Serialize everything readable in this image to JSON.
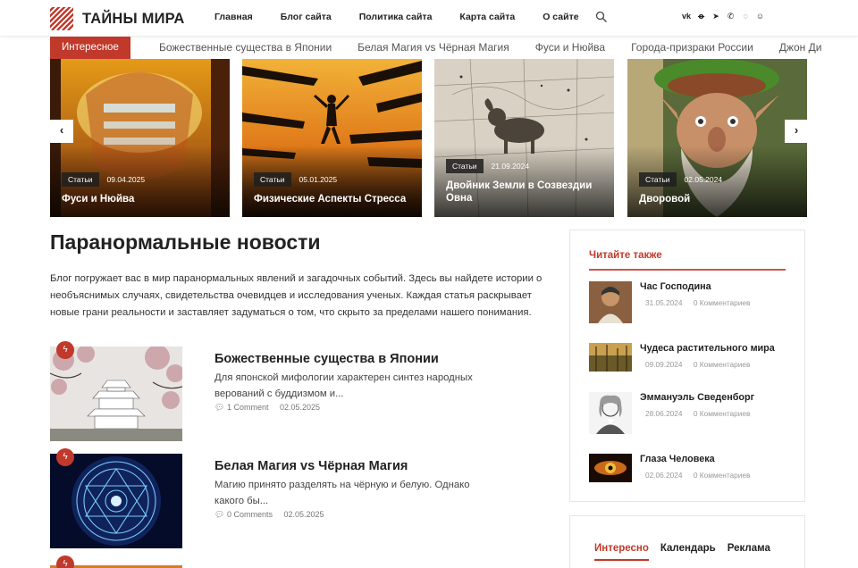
{
  "site": {
    "name": "ТАЙНЫ МИРА"
  },
  "nav": [
    "Главная",
    "Блог сайта",
    "Политика сайта",
    "Карта сайта",
    "О сайте"
  ],
  "icons": {
    "search": "search-icon",
    "socials": [
      "vk-icon",
      "ok-icon",
      "telegram-icon",
      "viber-icon",
      "whatsapp-icon",
      "vk-messenger-icon"
    ]
  },
  "ticker": {
    "label": "Интересное",
    "items": [
      "Божественные существа в Японии",
      "Белая Магия vs Чёрная Магия",
      "Фуси и Нюйва",
      "Города-призраки России",
      "Джон Ди"
    ]
  },
  "slider": {
    "prev": "‹",
    "next": "›",
    "cards": [
      {
        "tag": "Статьи",
        "date": "09.04.2025",
        "title": "Фуси и Нюйва"
      },
      {
        "tag": "Статьи",
        "date": "05.01.2025",
        "title": "Физические Аспекты Стресса"
      },
      {
        "tag": "Статьи",
        "date": "21.09.2024",
        "title": "Двойник Земли в Созвездии Овна"
      },
      {
        "tag": "Статьи",
        "date": "02.05.2024",
        "title": "Дворовой"
      }
    ]
  },
  "main": {
    "title": "Паранормальные новости",
    "intro": "Блог погружает вас в мир паранормальных явлений и загадочных событий. Здесь вы найдете истории о необъяснимых случаях, свидетельства очевидцев и исследования ученых. Каждая статья раскрывает новые грани реальности и заставляет задуматься о том, что скрыто за пределами нашего понимания.",
    "posts": [
      {
        "title": "Божественные существа в Японии",
        "excerpt": "Для японской мифологии характерен синтез народных верований с буддизмом и...",
        "comments": "1 Comment",
        "date": "02.05.2025"
      },
      {
        "title": "Белая Магия vs Чёрная Магия",
        "excerpt": "Магию принято разделять на чёрную и белую. Однако какого бы...",
        "comments": "0 Comments",
        "date": "02.05.2025"
      }
    ]
  },
  "sidebar": {
    "heading": "Читайте также",
    "items": [
      {
        "title": "Час Господина",
        "date": "31.05.2024",
        "comments": "0 Комментариев"
      },
      {
        "title": "Чудеса растительного мира",
        "date": "09.09.2024",
        "comments": "0 Комментариев"
      },
      {
        "title": "Эммануэль Сведенборг",
        "date": "28.06.2024",
        "comments": "0 Комментариев"
      },
      {
        "title": "Глаза Человека",
        "date": "02.06.2024",
        "comments": "0 Комментариев"
      }
    ],
    "tabs": [
      "Интересно",
      "Календарь",
      "Реклама"
    ]
  },
  "colors": {
    "accent": "#c0392b"
  }
}
